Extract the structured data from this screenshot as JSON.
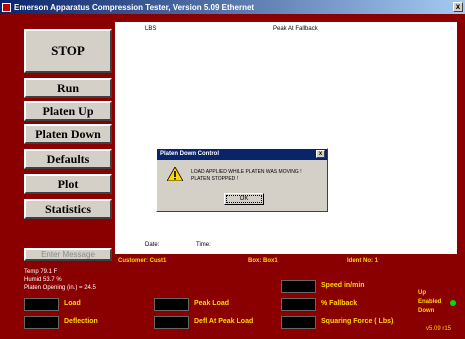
{
  "window": {
    "title": "Emerson Apparatus Compression Tester, Version 5.09 Ethernet",
    "close_glyph": "x"
  },
  "buttons": {
    "stop": "STOP",
    "run": "Run",
    "platen_up": "Platen Up",
    "platen_down": "Platen Down",
    "defaults": "Defaults",
    "plot": "Plot",
    "statistics": "Statistics",
    "enter_message": "Enter Message"
  },
  "plot": {
    "units_label": "LBS",
    "peak_label": "Peak At Fallback",
    "date_label": "Date:",
    "time_label": "Time:"
  },
  "dialog": {
    "title": "Platen Down Control",
    "close_glyph": "x",
    "line1": "LOAD APPLIED WHILE PLATEN WAS MOVING !",
    "line2": "PLATEN STOPPED !",
    "ok_label": "OK"
  },
  "info_bar": {
    "customer": "Customer: Cust1",
    "box": "Box: Box1",
    "ident": "Ident No: 1"
  },
  "status": {
    "temp": "Temp  79.1 F",
    "humid": "Humid  53.7 %",
    "platen_opening": "Platen Opening (in.) = 24.5"
  },
  "readouts": {
    "load": "Load",
    "deflection": "Deflection",
    "peak_load": "Peak Load",
    "defl_at_peak": "Defl At Peak Load",
    "speed": "Speed in/min",
    "fallback": "% Fallback",
    "squaring": "Squaring Force ( Lbs)"
  },
  "platen_state": {
    "up": "Up",
    "enabled": "Enabled",
    "down": "Down"
  },
  "version": "v5.09 r15",
  "colors": {
    "background": "#8a0000",
    "label": "#ffd700",
    "led": "#00e000"
  }
}
